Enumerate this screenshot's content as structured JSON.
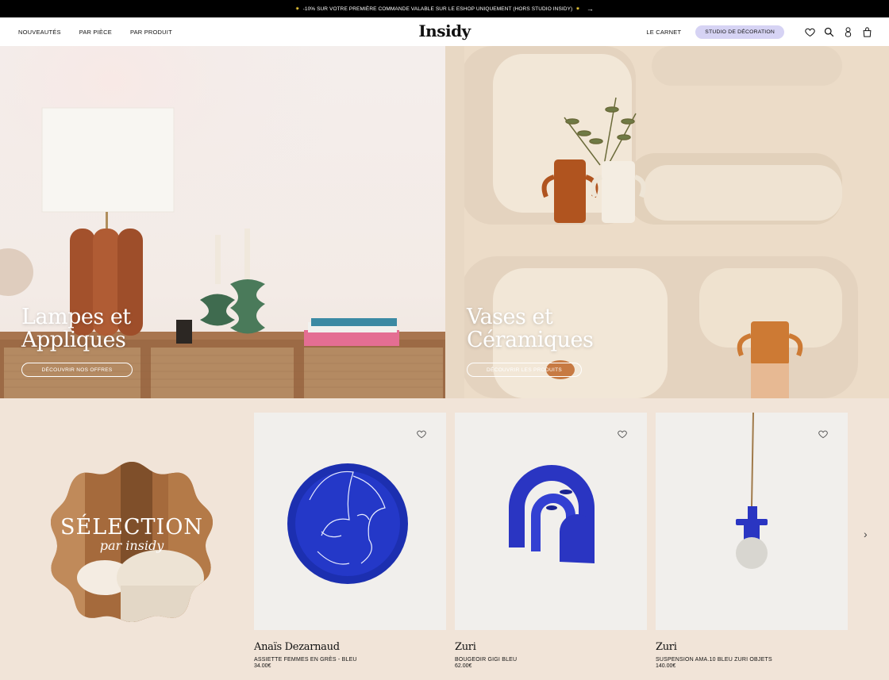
{
  "announcement": {
    "text": "-10% SUR VOTRE PREMIÈRE COMMANDE VALABLE SUR LE ESHOP UNIQUEMENT (HORS STUDIO INSIDY)",
    "star": "✷",
    "arrow": "→"
  },
  "header": {
    "nav_left": [
      "NOUVEAUTÉS",
      "PAR PIÈCE",
      "PAR PRODUIT"
    ],
    "logo": "Insidy",
    "carnet": "LE CARNET",
    "studio": "STUDIO DE DÉCORATION",
    "icons": [
      "heart-icon",
      "search-icon",
      "account-icon",
      "bag-icon"
    ]
  },
  "hero": {
    "left": {
      "title_line1": "Lampes et",
      "title_line2": "Appliques",
      "button": "DÉCOUVRIR NOS OFFRES"
    },
    "right": {
      "title_line1": "Vases et",
      "title_line2": "Céramiques",
      "button": "DÉCOUVRIR LES PRODUITS"
    }
  },
  "selection": {
    "title": "SÉLECTION",
    "subtitle": "par insidy",
    "next_icon": "chevron-right-icon",
    "products": [
      {
        "brand": "Anaïs Dezarnaud",
        "name": "ASSIETTE FEMMES EN GRÈS - BLEU",
        "price": "34.00€"
      },
      {
        "brand": "Zuri",
        "name": "BOUGEOIR GIGI BLEU",
        "price": "62.00€"
      },
      {
        "brand": "Zuri",
        "name": "SUSPENSION AMA.10 BLEU ZURI OBJETS",
        "price": "140.00€"
      }
    ]
  },
  "colors": {
    "accent_blue": "#2a3bc4",
    "studio_bg": "#d6d3f4",
    "section_bg": "#f1e4d8"
  },
  "next_arrow": "›"
}
